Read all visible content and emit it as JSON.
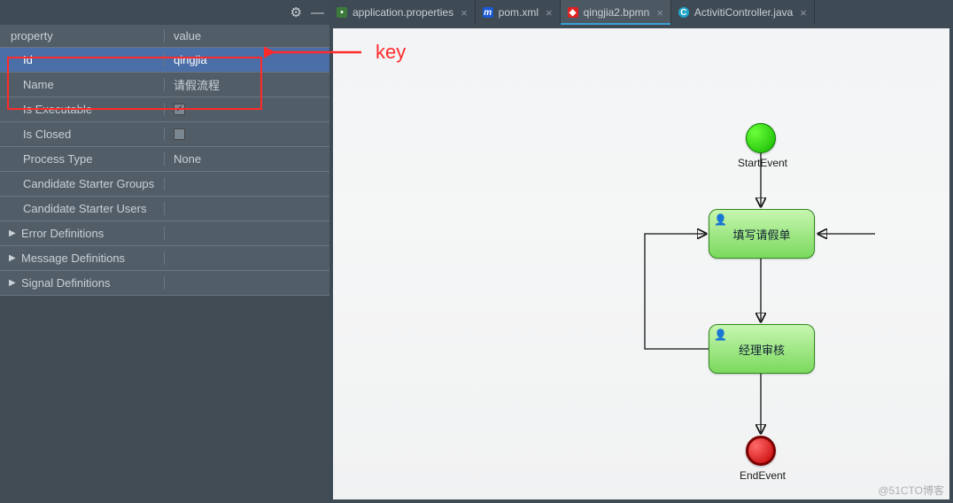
{
  "left_panel": {
    "header": {
      "col_property": "property",
      "col_value": "value"
    },
    "rows": [
      {
        "name": "Id",
        "value": "qingjia",
        "selected": true
      },
      {
        "name": "Name",
        "value": "请假流程"
      },
      {
        "name": "Is Executable",
        "checkbox": true,
        "checked": true
      },
      {
        "name": "Is Closed",
        "checkbox": true,
        "checked": false
      },
      {
        "name": "Process Type",
        "value": "None"
      },
      {
        "name": "Candidate Starter Groups",
        "value": ""
      },
      {
        "name": "Candidate Starter Users",
        "value": ""
      }
    ],
    "expandable": [
      {
        "label": "Error Definitions"
      },
      {
        "label": "Message Definitions"
      },
      {
        "label": "Signal Definitions"
      }
    ]
  },
  "tabs": [
    {
      "id": "application.properties",
      "label": "application.properties",
      "icon": "prop"
    },
    {
      "id": "pom.xml",
      "label": "pom.xml",
      "icon": "pom"
    },
    {
      "id": "qingjia2.bpmn",
      "label": "qingjia2.bpmn",
      "icon": "bpmn",
      "active": true
    },
    {
      "id": "ActivitiController.java",
      "label": "ActivitiController.java",
      "icon": "java"
    }
  ],
  "annotation": {
    "key_label": "key"
  },
  "diagram": {
    "start": {
      "label": "StartEvent"
    },
    "task1": {
      "label": "填写请假单"
    },
    "task2": {
      "label": "经理审核"
    },
    "end": {
      "label": "EndEvent"
    }
  },
  "watermark": "@51CTO博客"
}
